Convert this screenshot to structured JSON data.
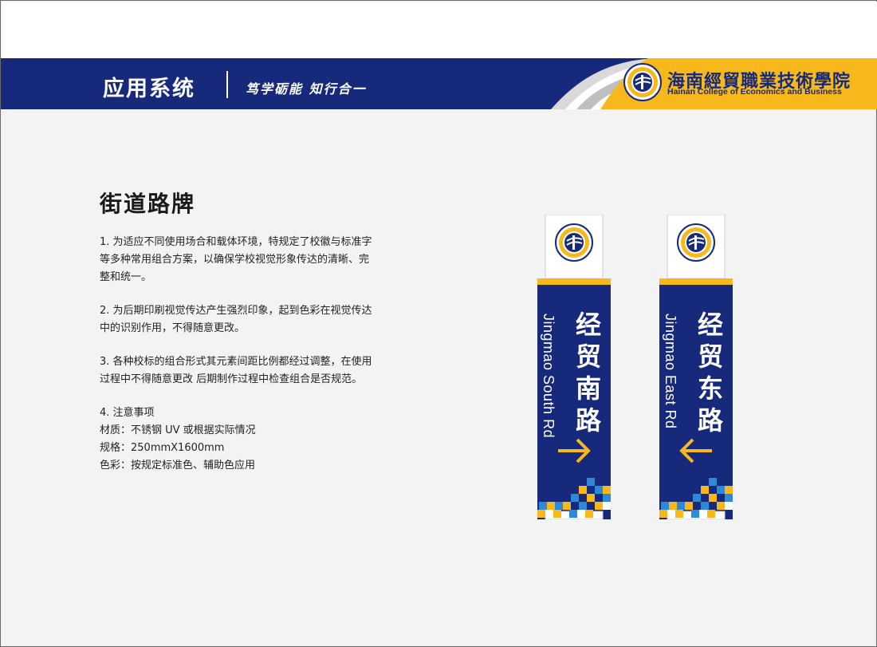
{
  "header": {
    "section_title": "应用系统",
    "motto": "笃学砺能 知行合一",
    "college_name_cn": "海南經貿職業技術學院",
    "college_name_en": "Hainan College of Economics and Business",
    "colors": {
      "navy": "#16297a",
      "yellow": "#f7b81b",
      "gray": "#bfbfbf"
    }
  },
  "content": {
    "heading": "街道路牌",
    "notes": [
      "1. 为适应不同使用场合和载体环境，特规定了校徽与标准字\n等多种常用组合方案，以确保学校视觉形象传达的清晰、完\n整和统一。",
      "2. 为后期印刷视觉传达产生强烈印象，起到色彩在视觉传达\n中的识别作用，不得随意更改。",
      "3. 各种校标的组合形式其元素间距比例都经过调整，在使用\n过程中不得随意更改  后期制作过程中检查组合是否规范。",
      "4. 注意事项\n材质：不锈钢 UV 或根据实际情况\n规格：250mmX1600mm\n色彩：按规定标准色、辅助色应用"
    ]
  },
  "signs": [
    {
      "name_cn": [
        "经",
        "贸",
        "南",
        "路"
      ],
      "name_en": "Jingmao South Rd",
      "arrow_icon": "arrow-right-icon"
    },
    {
      "name_cn": [
        "经",
        "贸",
        "东",
        "路"
      ],
      "name_en": "Jingmao East Rd",
      "arrow_icon": "arrow-left-icon"
    }
  ]
}
